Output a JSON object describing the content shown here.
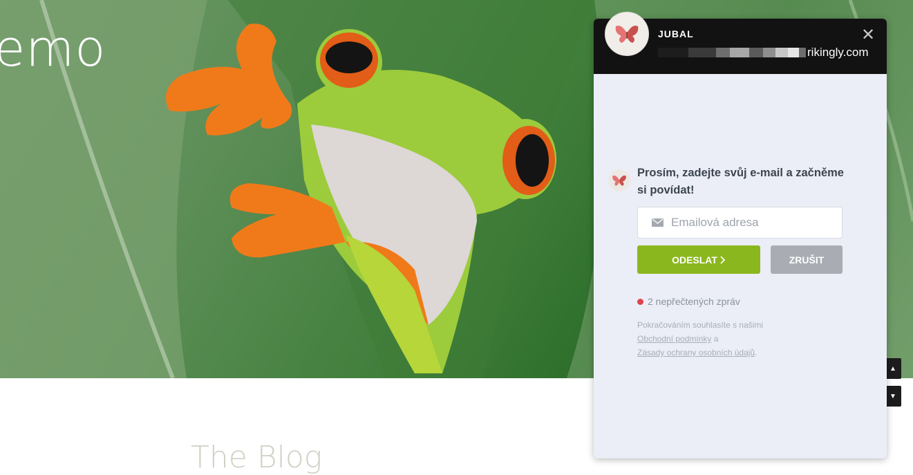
{
  "hero": {
    "title": "emo"
  },
  "blog": {
    "title": "The Blog"
  },
  "chat": {
    "header_name": "JUBAL",
    "header_domain": "rikingly.com",
    "close_symbol": "✕",
    "prompt": "Prosím, zadejte svůj e-mail a začněme si povídat!",
    "email_placeholder": "Emailová adresa",
    "send_label": "ODESLAT",
    "cancel_label": "ZRUŠIT",
    "unread_text": "2 nepřečtených zpráv",
    "terms_prefix": "Pokračováním souhlasíte s našimi",
    "terms_link": "Obchodní podmínky",
    "terms_and": "a",
    "privacy_link": "Zásady ochrany osobních údajů",
    "terms_end": "."
  },
  "scroll": {
    "up_symbol": "▲",
    "down_symbol": "▼"
  },
  "colors": {
    "send_button": "#8bb71e",
    "cancel_button": "#a9adb3",
    "header_bg": "#121212",
    "panel_bg": "#ebeef6",
    "unread_dot": "#e0424f"
  },
  "icons": [
    "butterfly-logo-icon",
    "mail-icon",
    "close-icon",
    "chevron-right-icon",
    "arrow-up-icon",
    "arrow-down-icon"
  ]
}
